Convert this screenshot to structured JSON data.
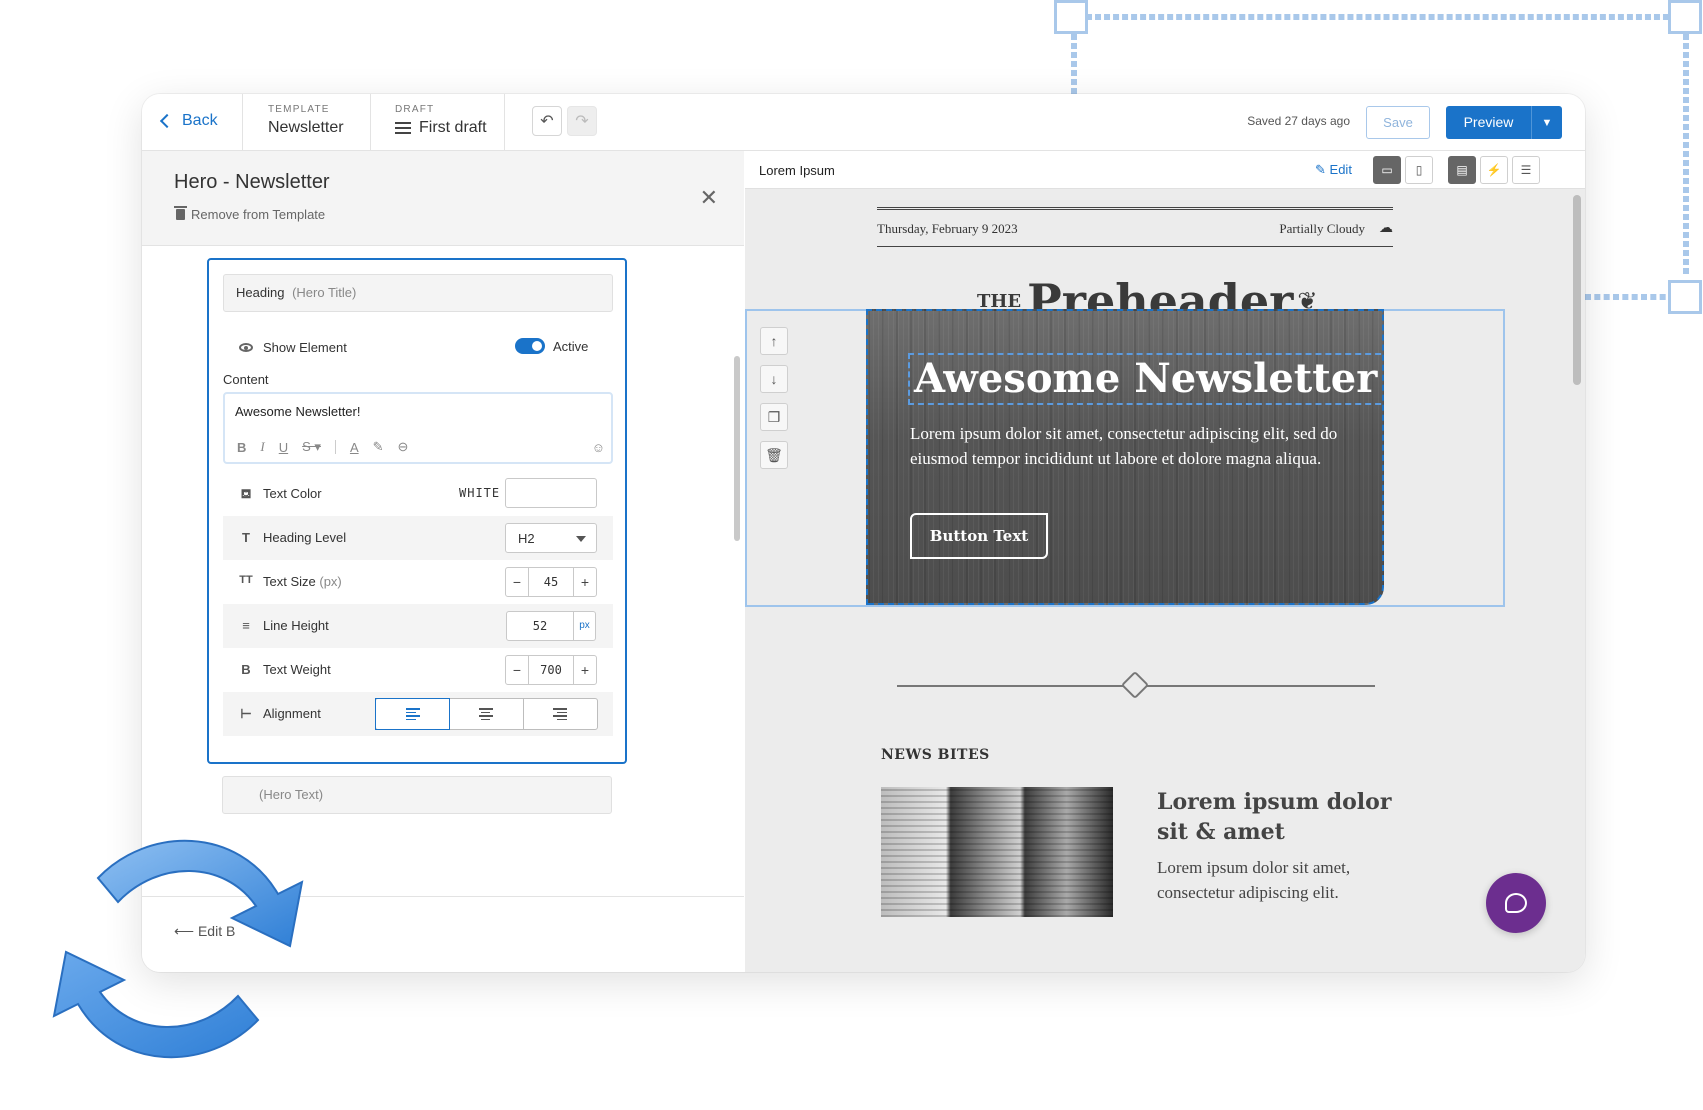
{
  "topbar": {
    "back_label": "Back",
    "template_label": "TEMPLATE",
    "template_value": "Newsletter",
    "draft_label": "DRAFT",
    "draft_value": "First draft",
    "saved_text": "Saved 27 days ago",
    "save_label": "Save",
    "preview_label": "Preview"
  },
  "left_panel": {
    "title": "Hero - Newsletter",
    "remove_label": "Remove from Template",
    "heading_field": "Heading",
    "heading_sub": "(Hero Title)",
    "show_element_label": "Show Element",
    "active_label": "Active",
    "content_label": "Content",
    "content_value": "Awesome Newsletter!",
    "text_color_label": "Text Color",
    "text_color_value": "WHITE",
    "heading_level_label": "Heading Level",
    "heading_level_value": "H2",
    "text_size_label": "Text Size",
    "text_size_unit": "(px)",
    "text_size_value": "45",
    "line_height_label": "Line Height",
    "line_height_value": "52",
    "line_height_unit": "px",
    "text_weight_label": "Text Weight",
    "text_weight_value": "700",
    "alignment_label": "Alignment",
    "alignment_selected": "left",
    "next_field_sub": "(Hero Text)",
    "footer_label": "Edit B"
  },
  "right_panel": {
    "name": "Lorem Ipsum",
    "edit_label": "Edit"
  },
  "email": {
    "date": "Thursday, February 9 2023",
    "weather": "Partially Cloudy",
    "masthead_the": "THE",
    "masthead_name": "Preheader",
    "hero_title": "Awesome Newsletter!",
    "hero_text": "Lorem ipsum dolor sit amet, consectetur adipiscing elit, sed do eiusmod tempor incididunt ut labore et dolore magna aliqua.",
    "hero_button": "Button Text",
    "news_section": "NEWS BITES",
    "news_headline": "Lorem ipsum dolor sit & amet",
    "news_body": "Lorem ipsum dolor sit amet, consectetur adipiscing elit."
  },
  "colors": {
    "accent": "#1a73c9",
    "chat": "#6c2e8f",
    "hero_bg": "#555555"
  },
  "icons": [
    "chevron-left-icon",
    "undo-icon",
    "redo-icon",
    "hamburger-icon",
    "trash-icon",
    "close-icon",
    "eye-icon",
    "bold-icon",
    "italic-icon",
    "underline-icon",
    "strikethrough-icon",
    "text-color-icon",
    "highlight-icon",
    "link-icon",
    "emoji-icon",
    "paint-bucket-icon",
    "heading-icon",
    "text-size-icon",
    "line-height-icon",
    "bold-weight-icon",
    "align-left-icon",
    "align-center-icon",
    "align-right-icon",
    "pencil-icon",
    "desktop-icon",
    "mobile-icon",
    "layout-icon",
    "bolt-icon",
    "lines-icon",
    "arrow-up-icon",
    "arrow-down-icon",
    "copy-icon",
    "chat-icon",
    "sync-icon"
  ]
}
